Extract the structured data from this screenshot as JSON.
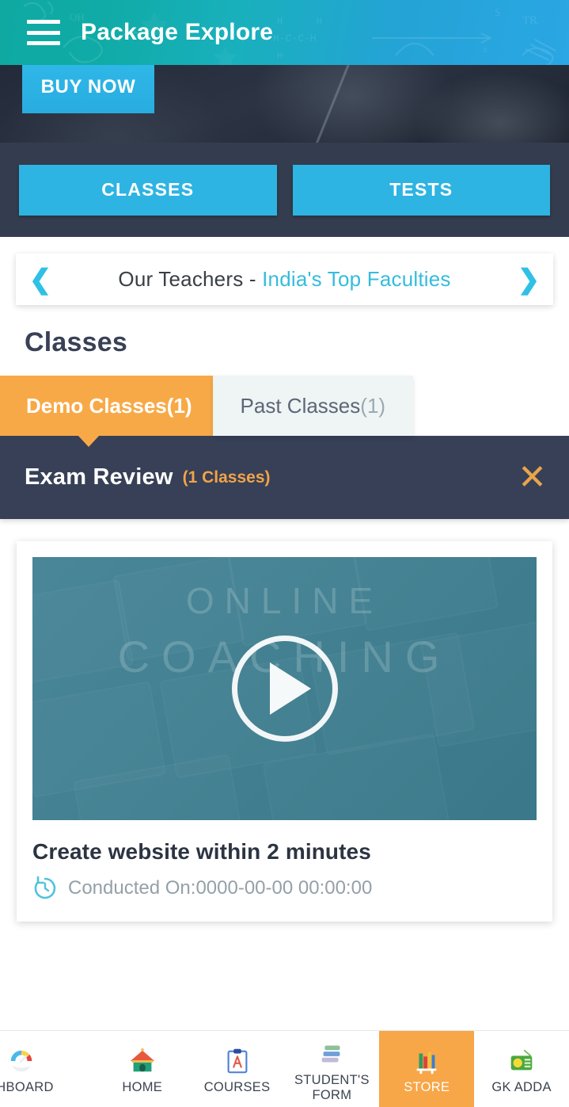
{
  "header": {
    "menu_icon": "hamburger-menu-icon",
    "title": "Package Explore"
  },
  "promo": {
    "buy_now_label": "BUY NOW"
  },
  "nav_buttons": [
    {
      "label": "CLASSES"
    },
    {
      "label": "TESTS"
    }
  ],
  "teachers_banner": {
    "prev_icon": "chevron-left-icon",
    "next_icon": "chevron-right-icon",
    "label": "Our Teachers - ",
    "highlight": "India's Top Faculties"
  },
  "section": {
    "title": "Classes"
  },
  "class_tabs": [
    {
      "label": "Demo Classes(1)",
      "active": true
    },
    {
      "label": "Past Classes",
      "count": "(1)",
      "active": false
    }
  ],
  "exam_bar": {
    "title": "Exam Review",
    "count": "(1 Classes)",
    "close_icon": "close-icon",
    "close_glyph": "✕"
  },
  "class_card": {
    "thumbnail_word_1": "ONLINE",
    "thumbnail_word_2": "COACHING",
    "play_icon": "play-button-icon",
    "title": "Create website within 2 minutes",
    "clock_icon": "stopwatch-icon",
    "meta": "Conducted On:0000-00-00 00:00:00"
  },
  "bottom_nav": [
    {
      "label": "SHBOARD",
      "icon": "dashboard-gauge-icon",
      "active": false
    },
    {
      "label": "HOME",
      "icon": "house-icon",
      "active": false
    },
    {
      "label": "COURSES",
      "icon": "clipboard-icon",
      "active": false
    },
    {
      "label": "STUDENT'S FORM",
      "icon": "books-stack-icon",
      "active": false
    },
    {
      "label": "STORE",
      "icon": "bookshelf-icon",
      "active": true
    },
    {
      "label": "GK ADDA",
      "icon": "radio-icon",
      "active": false
    }
  ],
  "colors": {
    "header_teal": "#0fa9a2",
    "header_blue": "#2aa7e4",
    "cyan_button": "#2eb4e2",
    "dark_navy": "#343d4f",
    "exam_bar": "#374056",
    "orange_accent": "#f8a947",
    "teal_thumb": "#3d7f92"
  }
}
